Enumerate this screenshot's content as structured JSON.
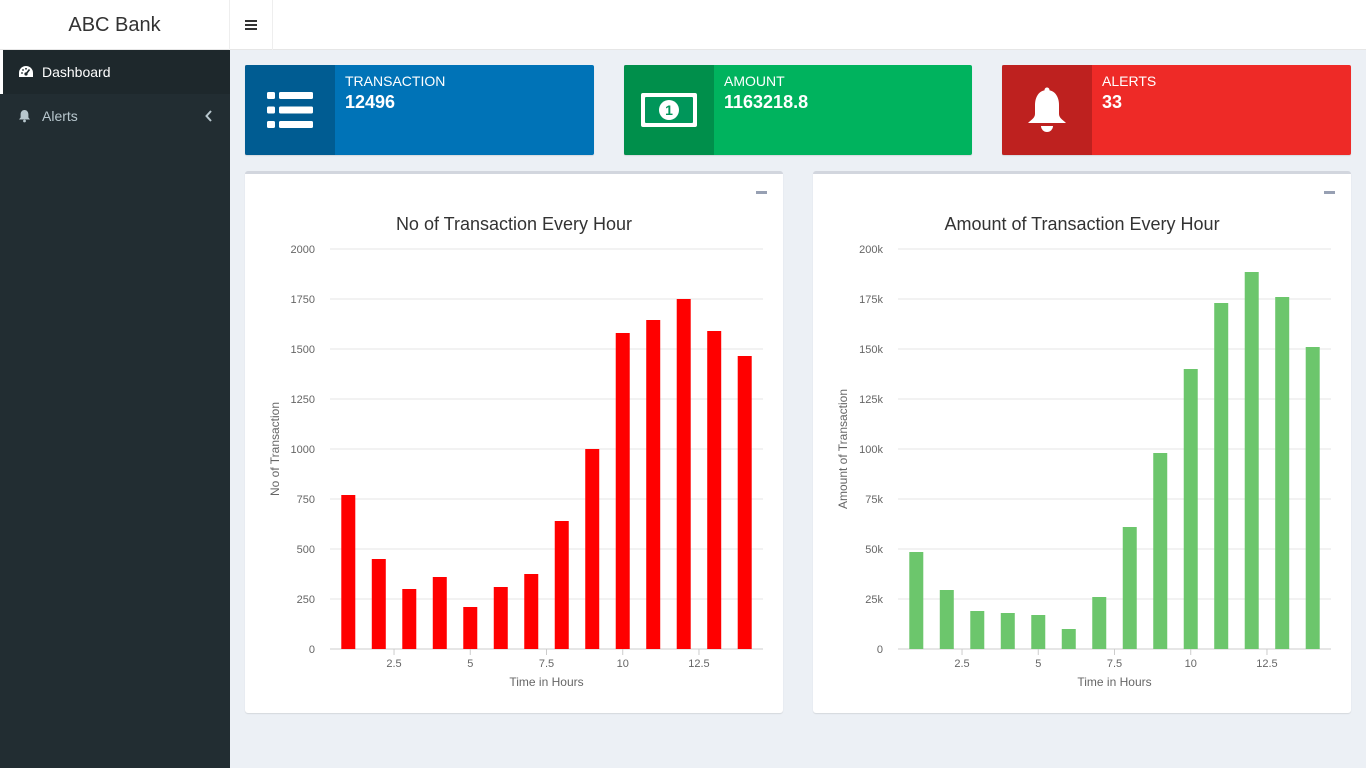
{
  "header": {
    "brand": "ABC Bank"
  },
  "sidebar": {
    "items": [
      {
        "label": "Dashboard",
        "icon": "dashboard-icon",
        "active": true
      },
      {
        "label": "Alerts",
        "icon": "bell-icon",
        "active": false
      }
    ]
  },
  "infoboxes": [
    {
      "label": "TRANSACTION",
      "value": "12496",
      "icon": "list-icon",
      "color": "#0073b7"
    },
    {
      "label": "AMOUNT",
      "value": "1163218.8",
      "icon": "money-icon",
      "color": "#00a65a"
    },
    {
      "label": "ALERTS",
      "value": "33",
      "icon": "bell-icon",
      "color": "#dd4b39"
    }
  ],
  "chart_data": [
    {
      "type": "bar",
      "title": "No of Transaction Every Hour",
      "xlabel": "Time in Hours",
      "ylabel": "No of Transaction",
      "x": [
        1,
        2,
        3,
        4,
        5,
        6,
        7,
        8,
        9,
        10,
        11,
        12,
        13,
        14
      ],
      "values": [
        770,
        450,
        300,
        360,
        210,
        310,
        375,
        640,
        1000,
        1580,
        1645,
        1750,
        1590,
        1465
      ],
      "ylim": [
        0,
        2000
      ],
      "xlim": [
        0.4,
        14.6
      ],
      "yticks": [
        0,
        250,
        500,
        750,
        1000,
        1250,
        1500,
        1750,
        2000
      ],
      "ytick_labels": [
        "0",
        "250",
        "500",
        "750",
        "1000",
        "1250",
        "1500",
        "1750",
        "2000"
      ],
      "xticks": [
        2.5,
        5,
        7.5,
        10,
        12.5
      ],
      "xtick_labels": [
        "2.5",
        "5",
        "7.5",
        "10",
        "12.5"
      ],
      "color": "#ff0000",
      "grid": true
    },
    {
      "type": "bar",
      "title": "Amount of Transaction Every Hour",
      "xlabel": "Time in Hours",
      "ylabel": "Amount of Transaction",
      "x": [
        1,
        2,
        3,
        4,
        5,
        6,
        7,
        8,
        9,
        10,
        11,
        12,
        13,
        14
      ],
      "values": [
        48500,
        29500,
        19000,
        18000,
        17000,
        10000,
        26000,
        61000,
        98000,
        140000,
        173000,
        188500,
        176000,
        151000
      ],
      "ylim": [
        0,
        200000
      ],
      "xlim": [
        0.4,
        14.6
      ],
      "yticks": [
        0,
        25000,
        50000,
        75000,
        100000,
        125000,
        150000,
        175000,
        200000
      ],
      "ytick_labels": [
        "0",
        "25k",
        "50k",
        "75k",
        "100k",
        "125k",
        "150k",
        "175k",
        "200k"
      ],
      "xticks": [
        2.5,
        5,
        7.5,
        10,
        12.5
      ],
      "xtick_labels": [
        "2.5",
        "5",
        "7.5",
        "10",
        "12.5"
      ],
      "color": "#6cc66c",
      "grid": true
    }
  ]
}
